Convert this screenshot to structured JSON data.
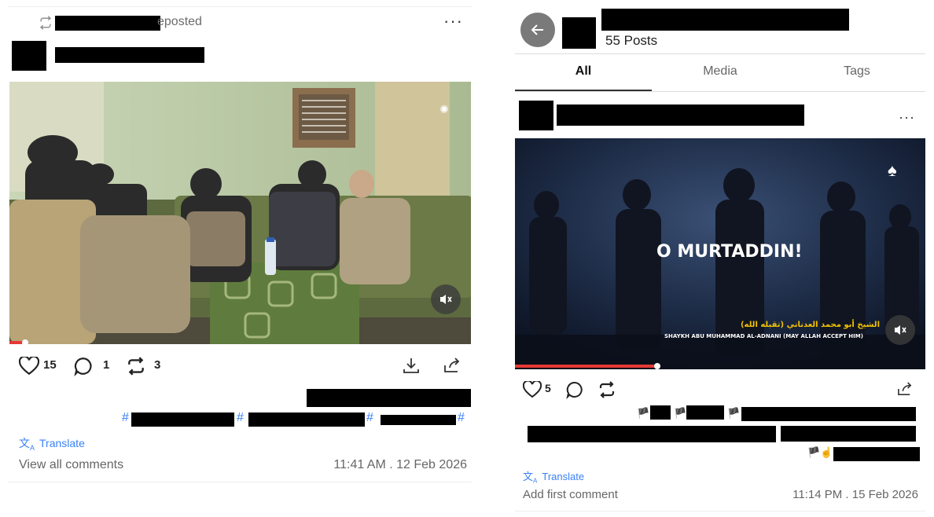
{
  "left_post": {
    "repost_label": "eposted",
    "more_icon": "more-horizontal-icon",
    "likes": "15",
    "comments": "1",
    "reposts": "3",
    "hashtag_symbol_1": "#",
    "hashtag_symbol_2": "#",
    "hashtag_symbol_3": "#",
    "hashtag_symbol_4": "#",
    "translate_label": "Translate",
    "comments_link": "View all comments",
    "timestamp": "11:41 AM . 12 Feb 2026",
    "video_progress": 0.03
  },
  "right_panel": {
    "posts_count": "55 Posts",
    "tabs": [
      {
        "label": "All",
        "active": true
      },
      {
        "label": "Media",
        "active": false
      },
      {
        "label": "Tags",
        "active": false
      }
    ],
    "post": {
      "more_icon": "more-horizontal-icon",
      "video_title_text": "O MURTADDIN!",
      "video_caption_arabic": "الشيخ أبو محمد العدناني (تقبله الله)",
      "video_caption_english": "SHAYKH ABU MUHAMMAD AL-ADNANI (MAY ALLAH ACCEPT HIM)",
      "likes": "5",
      "translate_label": "Translate",
      "comments_link": "Add first comment",
      "timestamp": "11:14 PM . 15 Feb 2026",
      "video_progress": 0.34
    }
  },
  "colors": {
    "accent_blue": "#3b82f6",
    "progress_red": "#e53935",
    "text_gray": "#666666",
    "caption_yellow": "#f2c200"
  }
}
